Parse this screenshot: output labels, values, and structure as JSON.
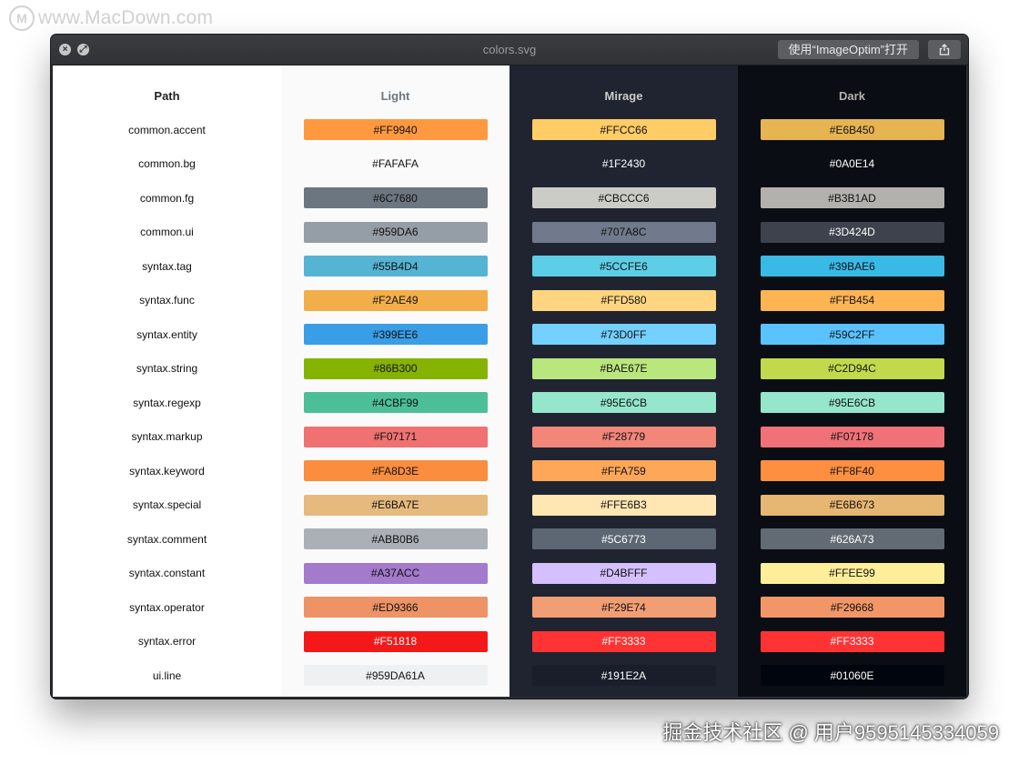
{
  "watermark_top": "www.MacDown.com",
  "watermark_bottom": "掘金技术社区 @ 用户9595145334059",
  "window": {
    "title": "colors.svg",
    "open_button": "使用“ImageOptim”打开"
  },
  "columns": {
    "path": "Path",
    "light": "Light",
    "mirage": "Mirage",
    "dark": "Dark"
  },
  "rows": [
    {
      "path": "common.accent",
      "light": "#FF9940",
      "mirage": "#FFCC66",
      "dark": "#E6B450"
    },
    {
      "path": "common.bg",
      "light": "#FAFAFA",
      "mirage": "#1F2430",
      "dark": "#0A0E14"
    },
    {
      "path": "common.fg",
      "light": "#6C7680",
      "mirage": "#CBCCC6",
      "dark": "#B3B1AD"
    },
    {
      "path": "common.ui",
      "light": "#959DA6",
      "mirage": "#707A8C",
      "dark": "#3D424D"
    },
    {
      "path": "syntax.tag",
      "light": "#55B4D4",
      "mirage": "#5CCFE6",
      "dark": "#39BAE6"
    },
    {
      "path": "syntax.func",
      "light": "#F2AE49",
      "mirage": "#FFD580",
      "dark": "#FFB454"
    },
    {
      "path": "syntax.entity",
      "light": "#399EE6",
      "mirage": "#73D0FF",
      "dark": "#59C2FF"
    },
    {
      "path": "syntax.string",
      "light": "#86B300",
      "mirage": "#BAE67E",
      "dark": "#C2D94C"
    },
    {
      "path": "syntax.regexp",
      "light": "#4CBF99",
      "mirage": "#95E6CB",
      "dark": "#95E6CB"
    },
    {
      "path": "syntax.markup",
      "light": "#F07171",
      "mirage": "#F28779",
      "dark": "#F07178"
    },
    {
      "path": "syntax.keyword",
      "light": "#FA8D3E",
      "mirage": "#FFA759",
      "dark": "#FF8F40"
    },
    {
      "path": "syntax.special",
      "light": "#E6BA7E",
      "mirage": "#FFE6B3",
      "dark": "#E6B673"
    },
    {
      "path": "syntax.comment",
      "light": "#ABB0B6",
      "mirage": "#5C6773",
      "dark": "#626A73"
    },
    {
      "path": "syntax.constant",
      "light": "#A37ACC",
      "mirage": "#D4BFFF",
      "dark": "#FFEE99"
    },
    {
      "path": "syntax.operator",
      "light": "#ED9366",
      "mirage": "#F29E74",
      "dark": "#F29668"
    },
    {
      "path": "syntax.error",
      "light": "#F51818",
      "mirage": "#FF3333",
      "dark": "#FF3333"
    },
    {
      "path": "ui.line",
      "light": "#959DA61A",
      "mirage": "#191E2A",
      "dark": "#01060E"
    }
  ]
}
